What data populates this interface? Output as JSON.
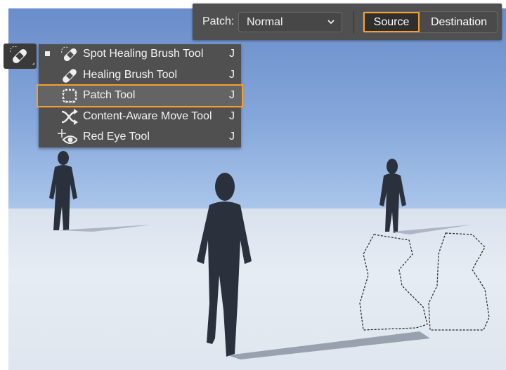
{
  "options_bar": {
    "patch_label": "Patch:",
    "mode_value": "Normal",
    "source_label": "Source",
    "destination_label": "Destination",
    "active_segment": "Source"
  },
  "tool_menu": {
    "items": [
      {
        "label": "Spot Healing Brush Tool",
        "shortcut": "J",
        "icon": "spot-healing-brush-icon",
        "current": true
      },
      {
        "label": "Healing Brush Tool",
        "shortcut": "J",
        "icon": "healing-brush-icon"
      },
      {
        "label": "Patch Tool",
        "shortcut": "J",
        "icon": "patch-icon",
        "highlighted": true
      },
      {
        "label": "Content-Aware Move Tool",
        "shortcut": "J",
        "icon": "content-aware-move-icon"
      },
      {
        "label": "Red Eye Tool",
        "shortcut": "J",
        "icon": "red-eye-icon"
      }
    ]
  },
  "colors": {
    "accent": "#f4a030",
    "panel": "#505050",
    "sky": "#6a8dcb"
  }
}
